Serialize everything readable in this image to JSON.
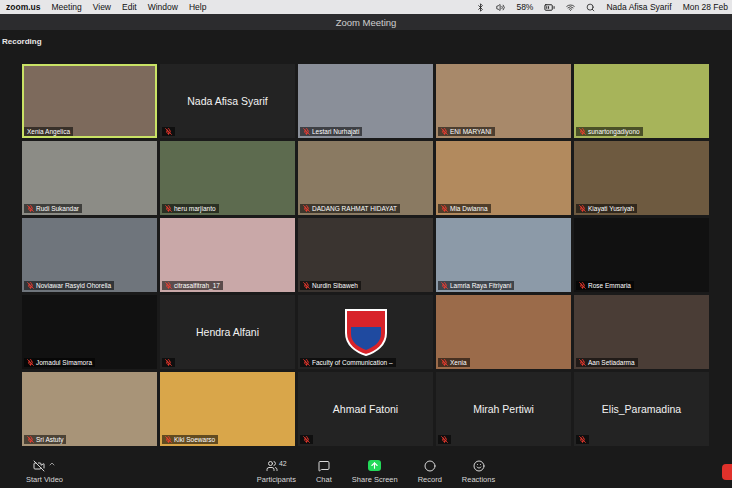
{
  "menu_bar": {
    "app": "zoom.us",
    "items": [
      "Meeting",
      "View",
      "Edit",
      "Window",
      "Help"
    ],
    "battery": "58%",
    "user": "Nada Afisa Syarif",
    "clock": "Mon 28 Feb"
  },
  "window": {
    "title": "Zoom Meeting"
  },
  "recording": {
    "label": "Recording"
  },
  "tiles": [
    {
      "name": "Xenia Angelica",
      "kind": "video",
      "muted": false,
      "active": true
    },
    {
      "name": "Nada Afisa Syarif",
      "kind": "name",
      "muted": true,
      "active": false
    },
    {
      "name": "Lestari Nurhajati",
      "kind": "video",
      "muted": true,
      "active": false
    },
    {
      "name": "ENI MARYANI",
      "kind": "video",
      "muted": true,
      "active": false
    },
    {
      "name": "sunartongadiyono",
      "kind": "video",
      "muted": true,
      "active": false
    },
    {
      "name": "Rudi Sukandar",
      "kind": "video",
      "muted": true,
      "active": false
    },
    {
      "name": "heru marjianto",
      "kind": "video",
      "muted": true,
      "active": false
    },
    {
      "name": "DADANG RAHMAT HIDAYAT",
      "kind": "video",
      "muted": true,
      "active": false
    },
    {
      "name": "Mia Dwianna",
      "kind": "video",
      "muted": true,
      "active": false
    },
    {
      "name": "Kiayati Yusriyah",
      "kind": "video",
      "muted": true,
      "active": false
    },
    {
      "name": "Noviawar Rasyid Ohorella",
      "kind": "video",
      "muted": true,
      "active": false
    },
    {
      "name": "citrasalfitrah_17",
      "kind": "video",
      "muted": true,
      "active": false
    },
    {
      "name": "Nurdin Sibaweh",
      "kind": "video",
      "muted": true,
      "active": false
    },
    {
      "name": "Lamria Raya Fitriyani",
      "kind": "video",
      "muted": true,
      "active": false
    },
    {
      "name": "Rose Emmaria",
      "kind": "blank",
      "muted": true,
      "active": false
    },
    {
      "name": "Jomadul Simamora",
      "kind": "blank",
      "muted": true,
      "active": false
    },
    {
      "name": "Hendra Alfani",
      "kind": "name",
      "muted": true,
      "active": false
    },
    {
      "name": "Faculty of Communication –",
      "kind": "logo",
      "muted": true,
      "active": false
    },
    {
      "name": "Xenia",
      "kind": "video",
      "muted": true,
      "active": false
    },
    {
      "name": "Aan Setiadarma",
      "kind": "video",
      "muted": true,
      "active": false
    },
    {
      "name": "Sri Astuty",
      "kind": "video",
      "muted": true,
      "active": false
    },
    {
      "name": "Kiki Soewarso",
      "kind": "video",
      "muted": true,
      "active": false
    },
    {
      "name": "Ahmad Fatoni",
      "kind": "name",
      "muted": true,
      "active": false
    },
    {
      "name": "Mirah Pertiwi",
      "kind": "name",
      "muted": true,
      "active": false
    },
    {
      "name": "Elis_Paramadina",
      "kind": "name",
      "muted": true,
      "active": false
    }
  ],
  "toolbar": {
    "items": [
      {
        "label": "Participants",
        "kind": "participants",
        "badge": "42"
      },
      {
        "label": "Chat",
        "kind": "chat"
      },
      {
        "label": "Share Screen",
        "kind": "share"
      },
      {
        "label": "Record",
        "kind": "record"
      },
      {
        "label": "Reactions",
        "kind": "reactions"
      }
    ],
    "video": {
      "label": "Start Video"
    }
  }
}
